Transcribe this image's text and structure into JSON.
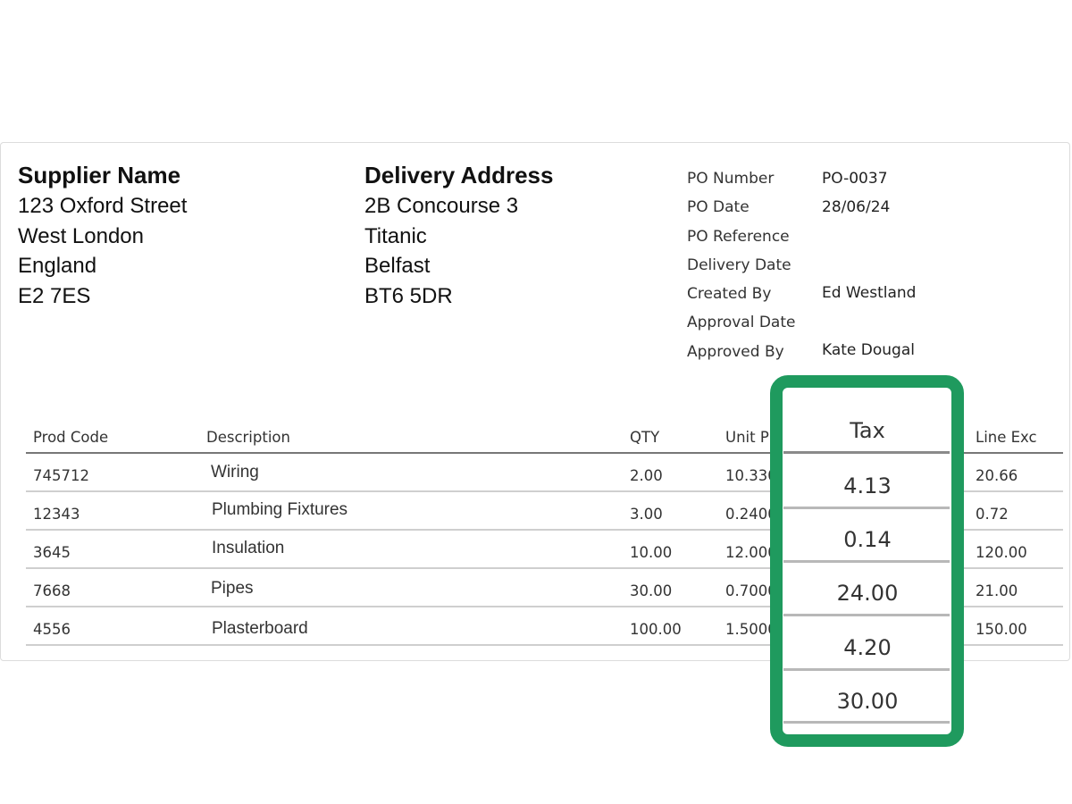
{
  "supplier": {
    "title": "Supplier Name",
    "lines": [
      "123 Oxford Street",
      "West London",
      "England",
      "E2 7ES"
    ]
  },
  "delivery": {
    "title": "Delivery Address",
    "lines": [
      "2B Concourse 3",
      "Titanic",
      "Belfast",
      "BT6 5DR"
    ]
  },
  "po_meta": [
    {
      "label": "PO Number",
      "value": "PO-0037"
    },
    {
      "label": "PO Date",
      "value": "28/06/24"
    },
    {
      "label": "PO Reference",
      "value": ""
    },
    {
      "label": "Delivery Date",
      "value": ""
    },
    {
      "label": "Created By",
      "value": "Ed Westland"
    },
    {
      "label": "Approval Date",
      "value": ""
    },
    {
      "label": "Approved By",
      "value": "Kate Dougal"
    }
  ],
  "table": {
    "headers": {
      "prod_code": "Prod Code",
      "description": "Description",
      "qty": "QTY",
      "unit_price": "Unit P",
      "tax": "Tax",
      "line_exc": "Line Exc"
    },
    "rows": [
      {
        "prod_code": "745712",
        "description": "Wiring",
        "qty": "2.00",
        "unit_price": "10.330",
        "line_exc": "20.66"
      },
      {
        "prod_code": "12343",
        "description": "Plumbing Fixtures",
        "qty": "3.00",
        "unit_price": "0.2400",
        "line_exc": "0.72"
      },
      {
        "prod_code": "3645",
        "description": "Insulation",
        "qty": "10.00",
        "unit_price": "12.000",
        "line_exc": "120.00"
      },
      {
        "prod_code": "7668",
        "description": "Pipes",
        "qty": "30.00",
        "unit_price": "0.7000",
        "line_exc": "21.00"
      },
      {
        "prod_code": "4556",
        "description": "Plasterboard",
        "qty": "100.00",
        "unit_price": "1.5000",
        "line_exc": "150.00"
      }
    ],
    "tax_values": [
      "4.13",
      "0.14",
      "24.00",
      "4.20",
      "30.00"
    ]
  },
  "colors": {
    "highlight_border": "#1f9a5e"
  }
}
